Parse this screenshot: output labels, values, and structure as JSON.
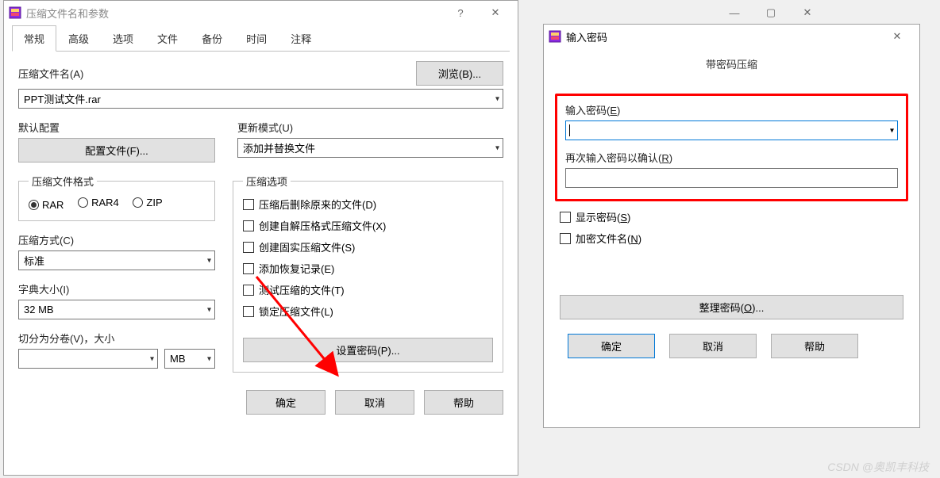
{
  "dlg1": {
    "title": "压缩文件名和参数",
    "tabs": [
      "常规",
      "高级",
      "选项",
      "文件",
      "备份",
      "时间",
      "注释"
    ],
    "archive_name_label": "压缩文件名(A)",
    "browse_btn": "浏览(B)...",
    "archive_name_value": "PPT测试文件.rar",
    "default_profile_label": "默认配置",
    "profiles_btn": "配置文件(F)...",
    "update_mode_label": "更新模式(U)",
    "update_mode_value": "添加并替换文件",
    "format_group": "压缩文件格式",
    "formats": [
      "RAR",
      "RAR4",
      "ZIP"
    ],
    "format_selected": "RAR",
    "method_label": "压缩方式(C)",
    "method_value": "标准",
    "dict_label": "字典大小(I)",
    "dict_value": "32 MB",
    "split_label": "切分为分卷(V)，大小",
    "split_unit": "MB",
    "options_group": "压缩选项",
    "options": [
      "压缩后删除原来的文件(D)",
      "创建自解压格式压缩文件(X)",
      "创建固实压缩文件(S)",
      "添加恢复记录(E)",
      "测试压缩的文件(T)",
      "锁定压缩文件(L)"
    ],
    "set_password_btn": "设置密码(P)...",
    "ok": "确定",
    "cancel": "取消",
    "help": "帮助"
  },
  "dlg2": {
    "title": "输入密码",
    "subtitle": "带密码压缩",
    "enter_label_pre": "输入密码(",
    "enter_label_u": "E",
    "enter_label_post": ")",
    "reenter_label_pre": "再次输入密码以确认(",
    "reenter_label_u": "R",
    "reenter_label_post": ")",
    "show_label_pre": "显示密码(",
    "show_label_u": "S",
    "show_label_post": ")",
    "encrypt_label_pre": "加密文件名(",
    "encrypt_label_u": "N",
    "encrypt_label_post": ")",
    "organize_btn_pre": "整理密码(",
    "organize_btn_u": "O",
    "organize_btn_post": ")...",
    "ok": "确定",
    "cancel": "取消",
    "help": "帮助"
  },
  "watermark": "CSDN @奥凯丰科技"
}
